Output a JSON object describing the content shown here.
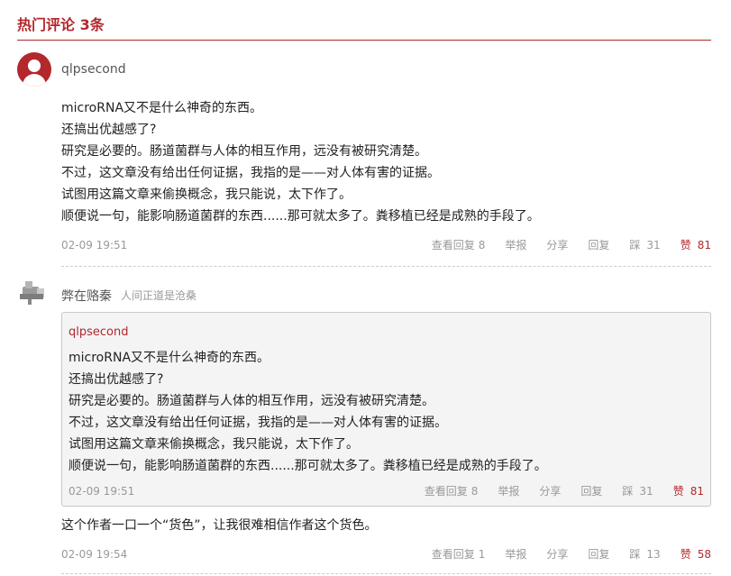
{
  "section": {
    "title": "热门评论 3条"
  },
  "comment1": {
    "username": "qlpsecond",
    "lines": [
      "microRNA又不是什么神奇的东西。",
      "还搞出优越感了?",
      "研究是必要的。肠道菌群与人体的相互作用，远没有被研究清楚。",
      "不过，这文章没有给出任何证据，我指的是——对人体有害的证据。",
      "试图用这篇文章来偷换概念，我只能说，太下作了。",
      "顺便说一句，能影响肠道菌群的东西......那可就太多了。粪移植已经是成熟的手段了。"
    ],
    "time": "02-09 19:51",
    "view_replies": "查看回复",
    "reply_count": "8",
    "report": "举报",
    "share": "分享",
    "reply": "回复",
    "dislike_count": "31",
    "like_count": "81"
  },
  "comment2": {
    "username": "弊在赂秦",
    "tagline": "人间正道是沧桑",
    "quote": {
      "username": "qlpsecond",
      "lines": [
        "microRNA又不是什么神奇的东西。",
        "还搞出优越感了?",
        "研究是必要的。肠道菌群与人体的相互作用，远没有被研究清楚。",
        "不过，这文章没有给出任何证据，我指的是——对人体有害的证据。",
        "试图用这篇文章来偷换概念，我只能说，太下作了。",
        "顺便说一句，能影响肠道菌群的东西......那可就太多了。粪移植已经是成熟的手段了。"
      ],
      "time": "02-09 19:51",
      "view_replies": "查看回复",
      "reply_count": "8",
      "report": "举报",
      "share": "分享",
      "reply": "回复",
      "dislike_count": "31",
      "like_count": "81"
    },
    "text": "这个作者一口一个“货色”，让我很难相信作者这个货色。",
    "time": "02-09 19:54",
    "view_replies": "查看回复",
    "reply_count": "1",
    "report": "举报",
    "share": "分享",
    "reply": "回复",
    "dislike_count": "13",
    "like_count": "58"
  },
  "icons": {
    "avatar1": "default-user-avatar",
    "dislike": "thumb-down-icon",
    "like": "thumb-up-icon"
  },
  "colors": {
    "accent": "#b3282d",
    "muted": "#999999",
    "quote_bg": "#f4f4f4"
  }
}
